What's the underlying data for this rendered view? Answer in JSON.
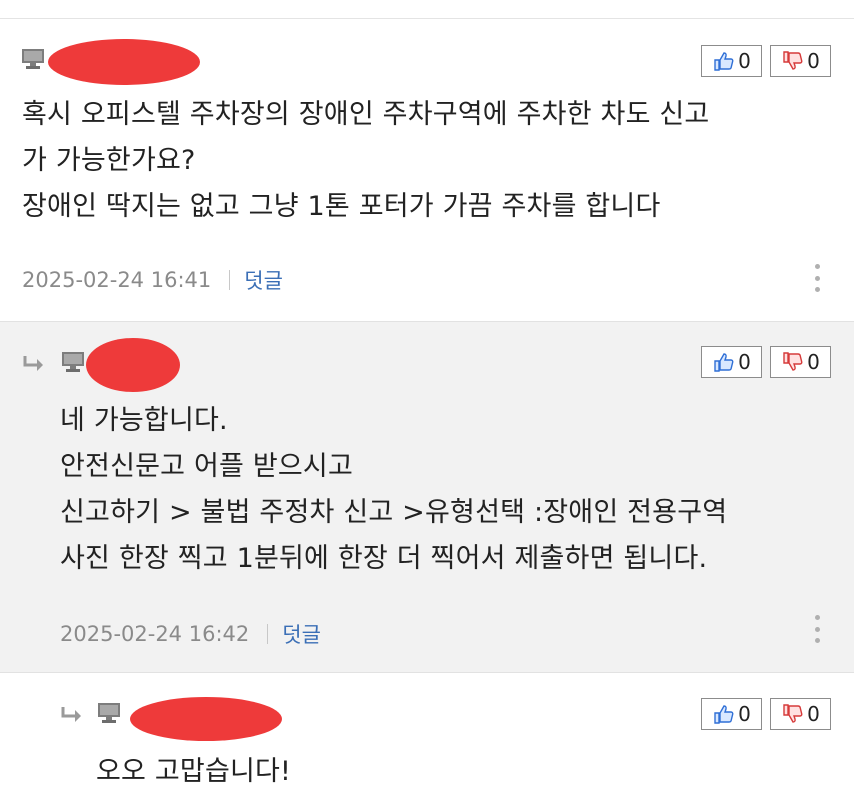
{
  "colors": {
    "redaction": "#ee3a3a",
    "link": "#3b6fb6",
    "meta": "#8a8a8a",
    "up_icon": "#2f6fd6",
    "down_icon": "#d63a3a"
  },
  "icons": {
    "pc": "desktop-pc-icon",
    "reply": "reply-arrow-icon",
    "up": "thumbs-up-icon",
    "down": "thumbs-down-icon",
    "more": "more-vertical-icon"
  },
  "comments": [
    {
      "author_redacted": true,
      "upvotes": "0",
      "downvotes": "0",
      "lines": [
        "혹시 오피스텔 주차장의 장애인 주차구역에 주차한 차도 신고",
        "가 가능한가요?",
        "장애인 딱지는 없고 그냥 1톤 포터가 가끔 주차를 합니다"
      ],
      "timestamp": "2025-02-24 16:41",
      "reply_label": "덧글"
    },
    {
      "author_redacted": true,
      "upvotes": "0",
      "downvotes": "0",
      "lines": [
        "네 가능합니다.",
        "안전신문고 어플 받으시고",
        "신고하기 > 불법 주정차 신고 >유형선택 :장애인 전용구역",
        "사진 한장 찍고 1분뒤에 한장 더 찍어서 제출하면 됩니다."
      ],
      "timestamp": "2025-02-24 16:42",
      "reply_label": "덧글"
    },
    {
      "author_redacted": true,
      "upvotes": "0",
      "downvotes": "0",
      "lines": [
        "오오 고맙습니다!"
      ]
    }
  ]
}
